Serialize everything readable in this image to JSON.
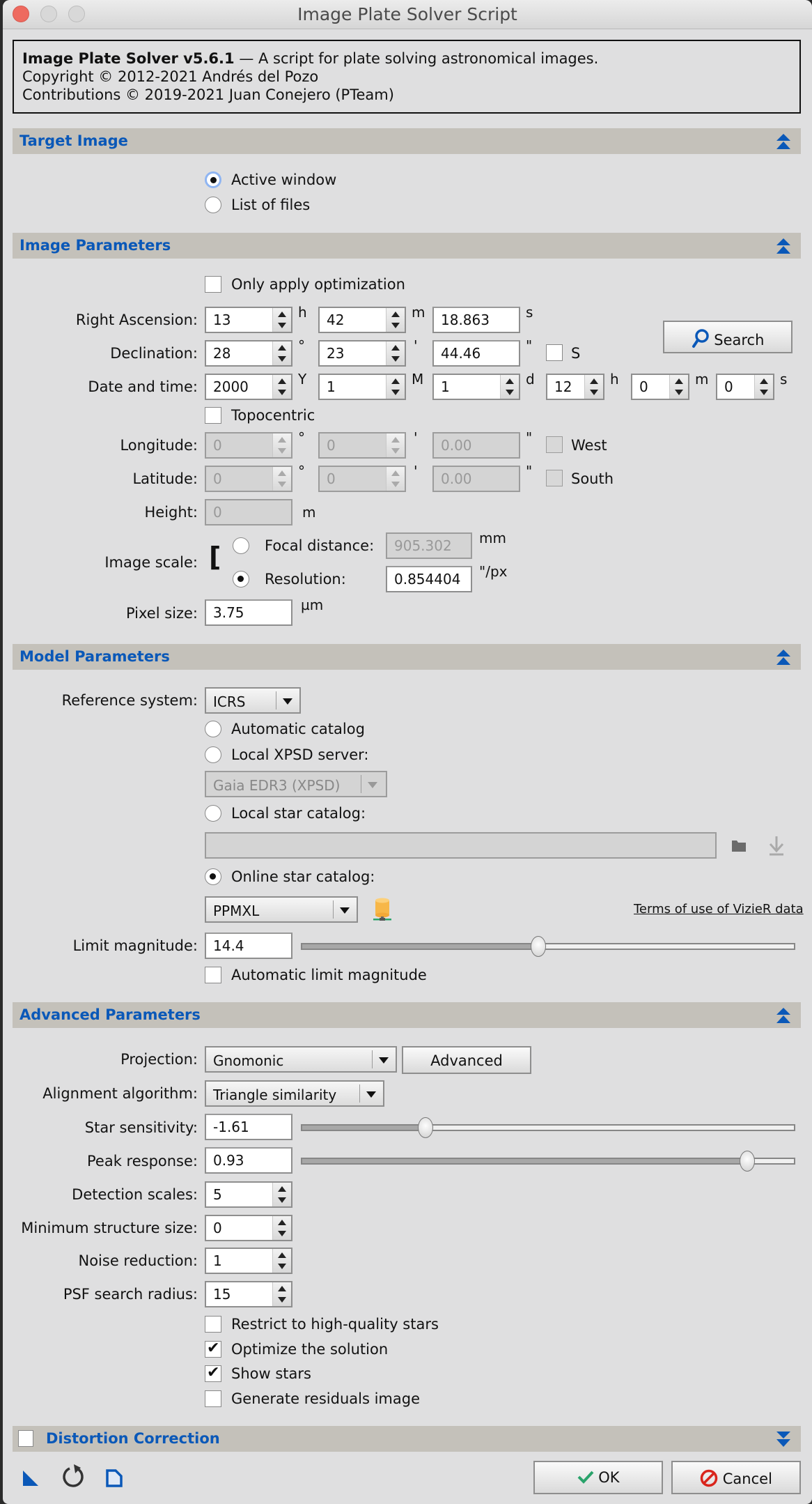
{
  "window": {
    "title": "Image Plate Solver Script"
  },
  "info": {
    "app_name": "Image Plate Solver v5.6.1",
    "tagline": " — A script for plate solving astronomical images.",
    "copyright": "Copyright © 2012-2021 Andrés del Pozo",
    "contributions": "Contributions © 2019-2021 Juan Conejero (PTeam)"
  },
  "sections": {
    "target_image": "Target Image",
    "image_parameters": "Image Parameters",
    "model_parameters": "Model Parameters",
    "advanced_parameters": "Advanced Parameters",
    "distortion_correction": "Distortion Correction"
  },
  "target": {
    "active_window": "Active window",
    "list_of_files": "List of files",
    "selected": "active_window"
  },
  "image_params": {
    "only_apply_optimization": {
      "label": "Only apply optimization",
      "checked": false
    },
    "ra": {
      "label": "Right Ascension:",
      "h": "13",
      "h_unit": "h",
      "m": "42",
      "m_unit": "m",
      "s": "18.863",
      "s_unit": "s"
    },
    "dec": {
      "label": "Declination:",
      "d": "28",
      "d_unit": "°",
      "m": "23",
      "m_unit": "'",
      "s": "44.46",
      "s_unit": "\"",
      "south_label": "S",
      "south": false
    },
    "search_label": "Search",
    "datetime": {
      "label": "Date and time:",
      "year": "2000",
      "y_unit": "Y",
      "month": "1",
      "mo_unit": "M",
      "day": "1",
      "d_unit": "d",
      "hour": "12",
      "h_unit": "h",
      "minute": "0",
      "mi_unit": "m",
      "second": "0",
      "s_unit": "s"
    },
    "topocentric": {
      "label": "Topocentric",
      "checked": false
    },
    "longitude": {
      "label": "Longitude:",
      "d": "0",
      "d_unit": "°",
      "m": "0",
      "m_unit": "'",
      "s": "0.00",
      "s_unit": "\"",
      "west_label": "West"
    },
    "latitude": {
      "label": "Latitude:",
      "d": "0",
      "d_unit": "°",
      "m": "0",
      "m_unit": "'",
      "s": "0.00",
      "s_unit": "\"",
      "south_label": "South"
    },
    "height": {
      "label": "Height:",
      "value": "0",
      "unit": "m"
    },
    "image_scale": {
      "label": "Image scale:",
      "focal_label": "Focal distance:",
      "focal_value": "905.302",
      "focal_unit": "mm",
      "resolution_label": "Resolution:",
      "resolution_value": "0.854404",
      "resolution_unit": "\"/px",
      "selected": "resolution"
    },
    "pixel_size": {
      "label": "Pixel size:",
      "value": "3.75",
      "unit": "µm"
    }
  },
  "model_params": {
    "reference_system": {
      "label": "Reference system:",
      "value": "ICRS"
    },
    "automatic_catalog": "Automatic catalog",
    "local_xpsd": "Local XPSD server:",
    "xpsd_value": "Gaia EDR3 (XPSD)",
    "local_star_catalog": "Local star catalog:",
    "local_path": "",
    "online_star_catalog": "Online star catalog:",
    "catalog_selected": "online",
    "online_value": "PPMXL",
    "terms_link": "Terms of use of VizieR data",
    "limit_magnitude": {
      "label": "Limit magnitude:",
      "value": "14.4",
      "slider_fraction": 0.48
    },
    "automatic_limit": {
      "label": "Automatic limit magnitude",
      "checked": false
    }
  },
  "advanced_params": {
    "projection": {
      "label": "Projection:",
      "value": "Gnomonic",
      "advanced_button": "Advanced"
    },
    "alignment": {
      "label": "Alignment algorithm:",
      "value": "Triangle similarity"
    },
    "star_sensitivity": {
      "label": "Star sensitivity:",
      "value": "-1.61",
      "slider_fraction": 0.25
    },
    "peak_response": {
      "label": "Peak response:",
      "value": "0.93",
      "slider_fraction": 0.905
    },
    "detection_scales": {
      "label": "Detection scales:",
      "value": "5"
    },
    "min_structure": {
      "label": "Minimum structure size:",
      "value": "0"
    },
    "noise_reduction": {
      "label": "Noise reduction:",
      "value": "1"
    },
    "psf_radius": {
      "label": "PSF search radius:",
      "value": "15"
    },
    "restrict_hq": {
      "label": "Restrict to high-quality stars",
      "checked": false
    },
    "optimize": {
      "label": "Optimize the solution",
      "checked": true
    },
    "show_stars": {
      "label": "Show stars",
      "checked": true
    },
    "residuals": {
      "label": "Generate residuals image",
      "checked": false
    }
  },
  "footer": {
    "ok": "OK",
    "cancel": "Cancel"
  },
  "colors": {
    "section_title": "#0a58b8",
    "section_bg": "#c4c1ba",
    "ok_check": "#2aa36b",
    "cancel_icon": "#d9251c",
    "db_icon": "#f7b748"
  }
}
